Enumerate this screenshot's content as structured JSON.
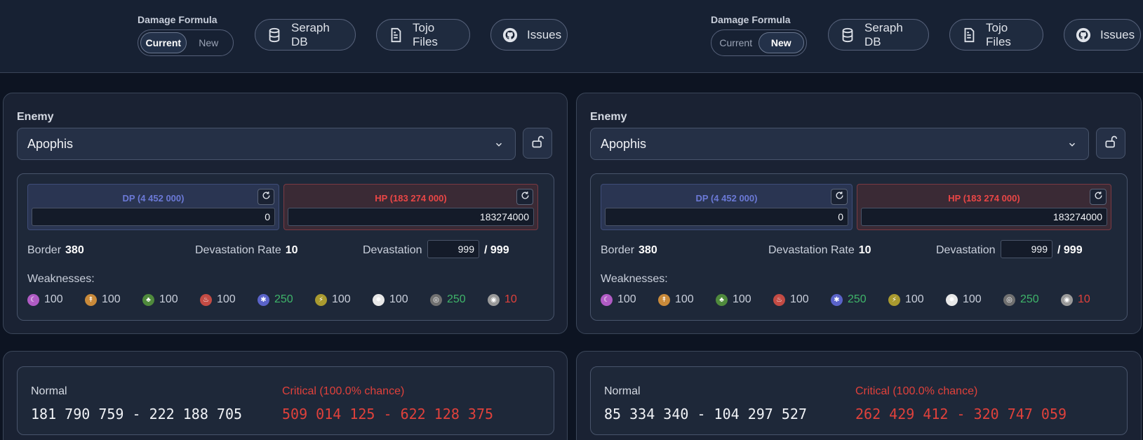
{
  "panels": [
    {
      "formula": {
        "label": "Damage Formula",
        "options": [
          "Current",
          "New"
        ],
        "selected": "Current"
      },
      "nav": [
        {
          "label": "Seraph DB",
          "icon": "database-icon"
        },
        {
          "label": "Tojo Files",
          "icon": "file-icon"
        },
        {
          "label": "Issues",
          "icon": "github-icon"
        }
      ],
      "enemy": {
        "label": "Enemy",
        "selected": "Apophis",
        "dp": {
          "title": "DP (4 452 000)",
          "value": "0"
        },
        "hp": {
          "title": "HP (183 274 000)",
          "value": "183274000"
        },
        "border_label": "Border",
        "border": "380",
        "rate_label": "Devastation Rate",
        "rate": "10",
        "devastation_label": "Devastation",
        "devastation": "999",
        "devastation_max": "/ 999",
        "weaknesses_label": "Weaknesses:",
        "weaknesses": [
          "100",
          "100",
          "100",
          "100",
          "250",
          "100",
          "100",
          "250",
          "10"
        ]
      },
      "result": {
        "normal_label": "Normal",
        "normal": "181 790 759 - 222 188 705",
        "critical_label": "Critical (100.0% chance)",
        "critical": "509 014 125 - 622 128 375"
      }
    },
    {
      "formula": {
        "label": "Damage Formula",
        "options": [
          "Current",
          "New"
        ],
        "selected": "New"
      },
      "nav": [
        {
          "label": "Seraph DB",
          "icon": "database-icon"
        },
        {
          "label": "Tojo Files",
          "icon": "file-icon"
        },
        {
          "label": "Issues",
          "icon": "github-icon"
        }
      ],
      "enemy": {
        "label": "Enemy",
        "selected": "Apophis",
        "dp": {
          "title": "DP (4 452 000)",
          "value": "0"
        },
        "hp": {
          "title": "HP (183 274 000)",
          "value": "183274000"
        },
        "border_label": "Border",
        "border": "380",
        "rate_label": "Devastation Rate",
        "rate": "10",
        "devastation_label": "Devastation",
        "devastation": "999",
        "devastation_max": "/ 999",
        "weaknesses_label": "Weaknesses:",
        "weaknesses": [
          "100",
          "100",
          "100",
          "100",
          "250",
          "100",
          "100",
          "250",
          "10"
        ]
      },
      "result": {
        "normal_label": "Normal",
        "normal": "85 334 340 - 104 297 527",
        "critical_label": "Critical (100.0% chance)",
        "critical": "262 429 412 - 320 747 059"
      }
    }
  ],
  "element_colors": [
    "#b05bc4",
    "#c98a3a",
    "#4f8a3c",
    "#c34b44",
    "#5a63c9",
    "#a99a2f",
    "#e8e8e8",
    "#707070",
    "#9a9a9a"
  ],
  "element_icons": [
    "dark-element-icon",
    "wind-element-icon",
    "earth-element-icon",
    "fire-element-icon",
    "ice-element-icon",
    "thunder-element-icon",
    "light-element-icon",
    "void-element-icon",
    "neutral-element-icon"
  ]
}
